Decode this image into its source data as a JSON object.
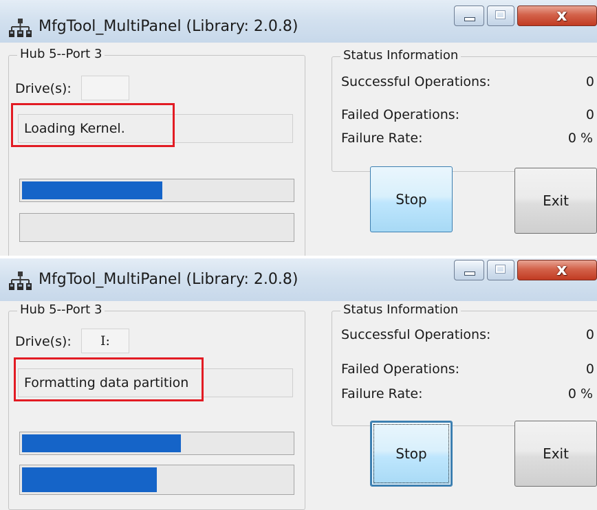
{
  "windows": [
    {
      "title": "MfgTool_MultiPanel (Library: 2.0.8)",
      "hub_port": "Hub 5--Port 3",
      "drive_label": "Drive(s):",
      "drive_value": "",
      "status_message": "Loading Kernel.",
      "progress_top": 0.52,
      "progress_bottom": 0.0,
      "status_info": {
        "legend": "Status Information",
        "successful_label": "Successful Operations:",
        "successful_value": "0",
        "failed_label": "Failed Operations:",
        "failed_value": "0",
        "failure_rate_label": "Failure Rate:",
        "failure_rate_value": "0 %"
      },
      "stop_label": "Stop",
      "exit_label": "Exit",
      "stop_focused": false
    },
    {
      "title": "MfgTool_MultiPanel (Library: 2.0.8)",
      "hub_port": "Hub 5--Port 3",
      "drive_label": "Drive(s):",
      "drive_value": "I:",
      "status_message": "Formatting data partition",
      "progress_top": 0.59,
      "progress_bottom": 0.5,
      "status_info": {
        "legend": "Status Information",
        "successful_label": "Successful Operations:",
        "successful_value": "0",
        "failed_label": "Failed Operations:",
        "failed_value": "0",
        "failure_rate_label": "Failure Rate:",
        "failure_rate_value": "0 %"
      },
      "stop_label": "Stop",
      "exit_label": "Exit",
      "stop_focused": true
    }
  ],
  "colors": {
    "highlight": "#e21b23",
    "progress_fill": "#1564c8",
    "stop_button_border": "#3c7fb1",
    "close_button": "#c13b22"
  },
  "icons": [
    "app-network-icon",
    "minimize-icon",
    "maximize-icon",
    "close-icon"
  ]
}
